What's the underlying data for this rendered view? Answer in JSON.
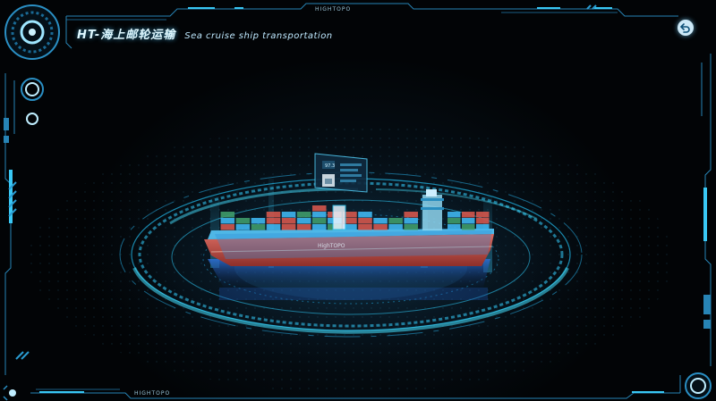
{
  "header": {
    "title": "HT-海上邮轮运输",
    "subtitle": "Sea cruise ship transportation",
    "brand_top": "HIGHTOPO",
    "brand_bottom": "HIGHTOPO"
  },
  "ship": {
    "hull_text": "HighTOPO",
    "panel_value": "97.3"
  },
  "controls": {
    "back_icon": "back-arrow-icon"
  },
  "colors": {
    "accent": "#29c4f0",
    "frame": "#1f6f99",
    "hull": "#c0504a",
    "container_blue": "#3fb6f0",
    "container_red": "#d3574c",
    "container_green": "#3f9b6a"
  }
}
